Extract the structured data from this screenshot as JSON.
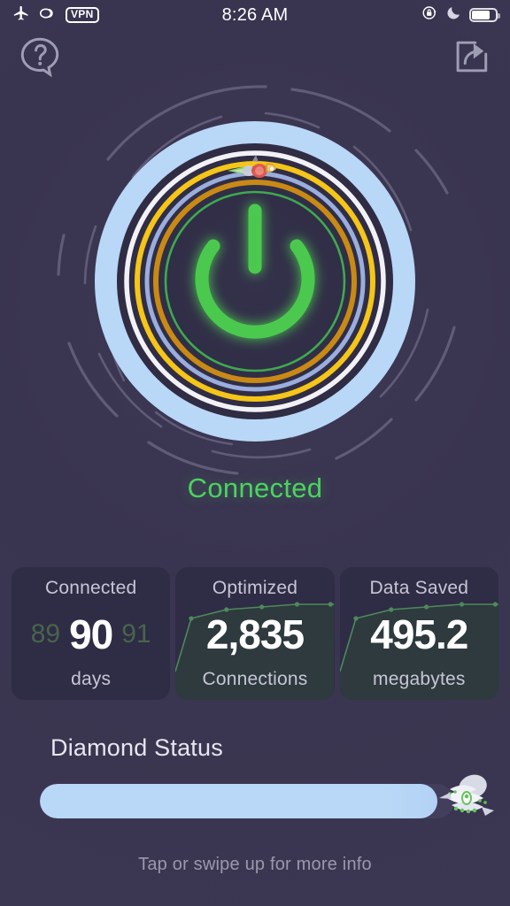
{
  "statusbar": {
    "time": "8:26 AM",
    "icons": {
      "airplane": "airplane-mode-icon",
      "link": "link-icon",
      "vpn_badge": "VPN",
      "rotation_lock": "rotation-lock-icon",
      "do_not_disturb": "moon-icon",
      "battery": "battery-icon"
    }
  },
  "topnav": {
    "help_icon": "help-question-bubble-icon",
    "share_icon": "share-icon"
  },
  "dial": {
    "power_icon": "power-button-icon",
    "status_text": "Connected",
    "status_color": "#4bd35f",
    "orbit_rocket_icon": "rocket-mascot-icon",
    "rings": [
      {
        "name": "halo",
        "color": "#b9d7f7"
      },
      {
        "name": "white",
        "color": "#f2f2f6"
      },
      {
        "name": "yellow",
        "color": "#f5c518"
      },
      {
        "name": "periwinkle",
        "color": "#9aaedd"
      },
      {
        "name": "orange",
        "color": "#c98a15"
      },
      {
        "name": "green",
        "color": "#3fa94f"
      }
    ]
  },
  "cards": [
    {
      "title": "Connected",
      "value": "90",
      "unit": "days",
      "ghost_prev": "89",
      "ghost_next": "91",
      "has_chart": false
    },
    {
      "title": "Optimized",
      "value": "2,835",
      "unit": "Connections",
      "ghost_prev": "",
      "ghost_next": "",
      "has_chart": true
    },
    {
      "title": "Data Saved",
      "value": "495.2",
      "unit": "megabytes",
      "ghost_prev": "",
      "ghost_next": "",
      "has_chart": true
    }
  ],
  "diamond": {
    "title": "Diamond Status",
    "progress_percent": 96,
    "bar_color": "#b9d7f7",
    "rocket_icon": "rocket-icon"
  },
  "footer": {
    "hint": "Tap or swipe up for more info"
  }
}
